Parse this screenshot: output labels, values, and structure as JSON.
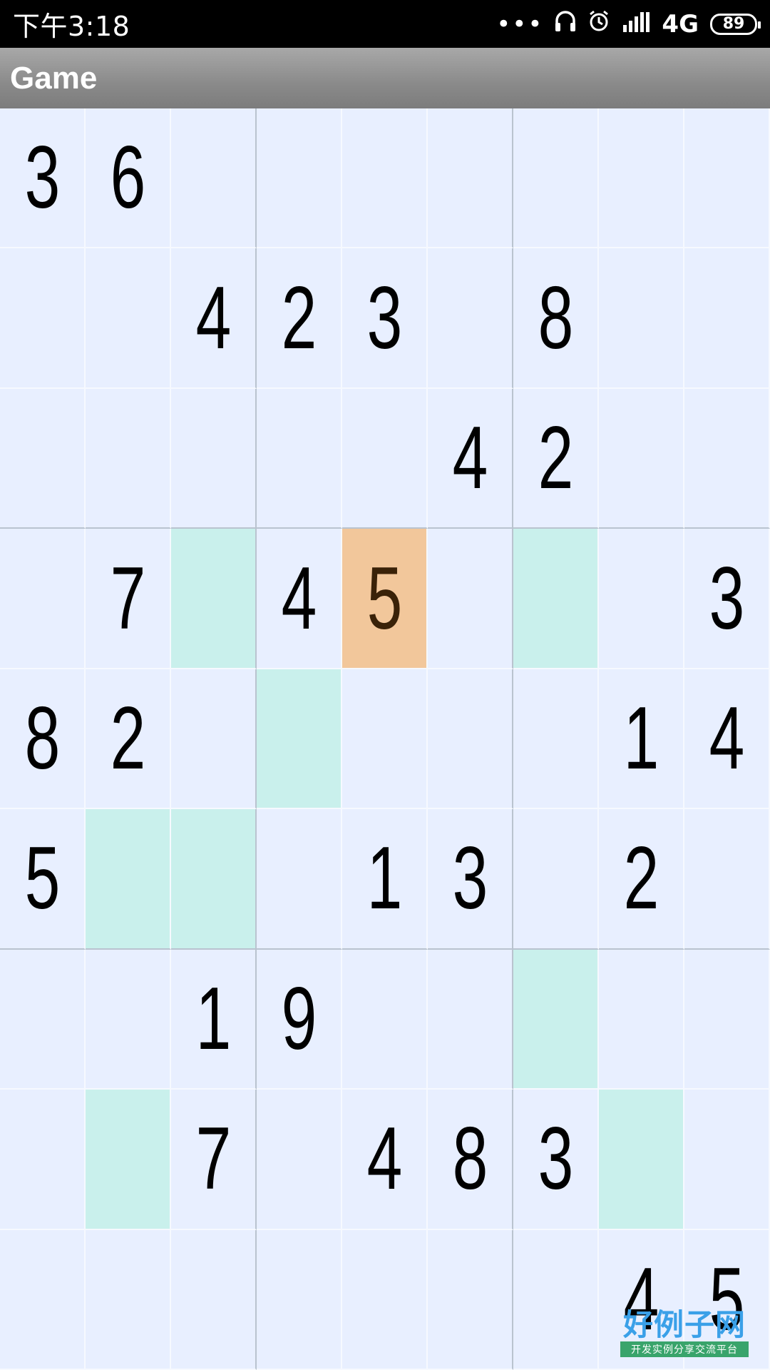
{
  "status_bar": {
    "time": "下午3:18",
    "network": "4G",
    "battery": "89"
  },
  "app_bar": {
    "title": "Game"
  },
  "board": {
    "size": 9,
    "selected": [
      3,
      4
    ],
    "rows": [
      [
        "3",
        "6",
        "",
        "",
        "",
        "",
        "",
        "",
        ""
      ],
      [
        "",
        "",
        "4",
        "2",
        "3",
        "",
        "8",
        "",
        ""
      ],
      [
        "",
        "",
        "",
        "",
        "",
        "4",
        "2",
        "",
        ""
      ],
      [
        "",
        "7",
        "",
        "4",
        "5",
        "",
        "",
        "",
        "3"
      ],
      [
        "8",
        "2",
        "",
        "",
        "",
        "",
        "",
        "1",
        "4"
      ],
      [
        "5",
        "",
        "",
        "",
        "1",
        "3",
        "",
        "2",
        ""
      ],
      [
        "",
        "",
        "1",
        "9",
        "",
        "",
        "",
        "",
        ""
      ],
      [
        "",
        "",
        "7",
        "",
        "4",
        "8",
        "3",
        "",
        ""
      ],
      [
        "",
        "",
        "",
        "",
        "",
        "",
        "",
        "4",
        "5"
      ]
    ],
    "highlighted": [
      [
        3,
        2
      ],
      [
        3,
        6
      ],
      [
        4,
        3
      ],
      [
        5,
        1
      ],
      [
        5,
        2
      ],
      [
        6,
        6
      ],
      [
        7,
        1
      ],
      [
        7,
        7
      ]
    ]
  },
  "watermark": {
    "logo_text": "好例子网",
    "logo_sub": "开发实例分享交流平台"
  },
  "colors": {
    "cell_bg": "#e8efff",
    "highlight": "#c9f0ec",
    "selected": "#f2c79b"
  }
}
